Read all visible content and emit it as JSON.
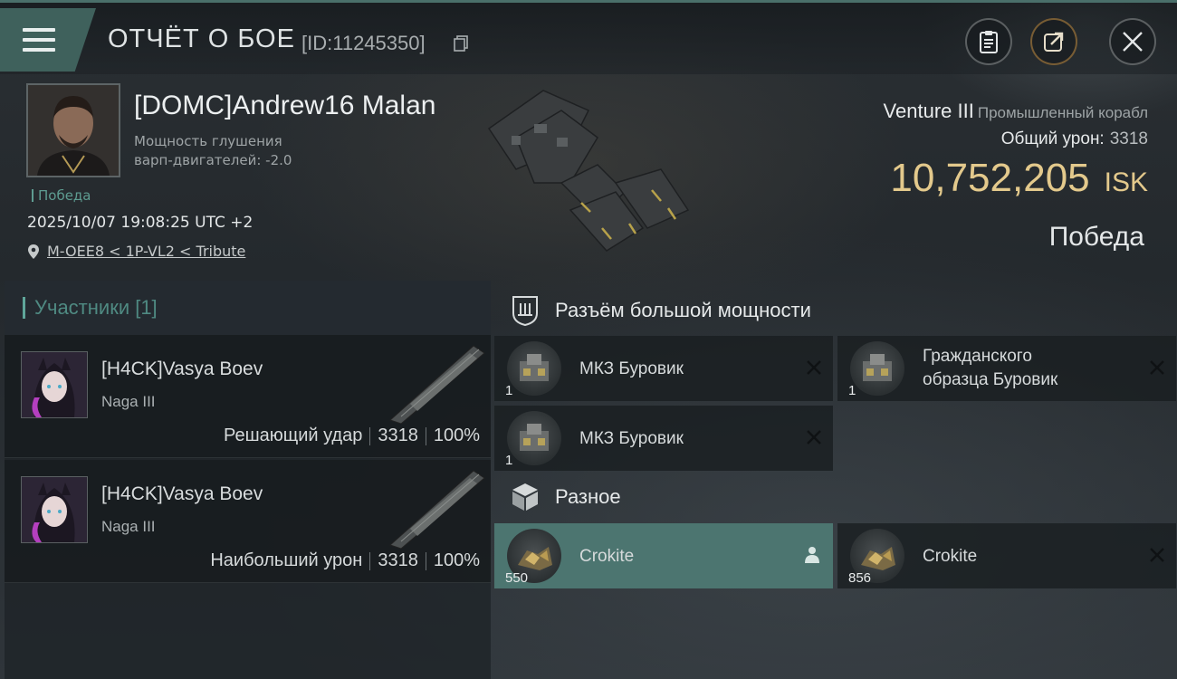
{
  "header": {
    "title": "ОТЧЁТ О БОЕ",
    "report_id": "[ID:11245350]"
  },
  "victim": {
    "name": "[DOMC]Andrew16 Malan",
    "note_line1": "Мощность глушения",
    "note_line2": "варп-двигателей: -2.0",
    "victory_tag": "Победа",
    "datetime": "2025/10/07 19:08:25 UTC +2",
    "location": "M-OEE8 < 1P-VL2 < Tribute",
    "ship_name": "Venture III",
    "ship_class": "Промышленный корабл",
    "total_damage_label": "Общий урон:",
    "total_damage_value": "3318",
    "isk_value": "10,752,205",
    "isk_unit": "ISK",
    "result": "Победа"
  },
  "participants": {
    "header": "Участники [1]",
    "items": [
      {
        "name": "[H4CK]Vasya Boev",
        "ship": "Naga III",
        "role": "Решающий удар",
        "damage": "3318",
        "percent": "100%"
      },
      {
        "name": "[H4CK]Vasya Boev",
        "ship": "Naga III",
        "role": "Наибольший урон",
        "damage": "3318",
        "percent": "100%"
      }
    ]
  },
  "modules": {
    "high_slot_title": "Разъём большой мощности",
    "high_slot_items": [
      {
        "name": "МКЗ Буровик",
        "qty": "1",
        "status": "destroyed"
      },
      {
        "name_line1": "Гражданского",
        "name_line2": "образца Буровик",
        "qty": "1",
        "status": "destroyed"
      },
      {
        "name": "МКЗ Буровик",
        "qty": "1",
        "status": "destroyed"
      }
    ],
    "misc_title": "Разное",
    "misc_items": [
      {
        "name": "Crokite",
        "qty": "550",
        "status": "dropped"
      },
      {
        "name": "Crokite",
        "qty": "856",
        "status": "destroyed"
      }
    ]
  },
  "colors": {
    "accent_teal": "#4c7570",
    "isk_gold": "#e3c98c"
  }
}
